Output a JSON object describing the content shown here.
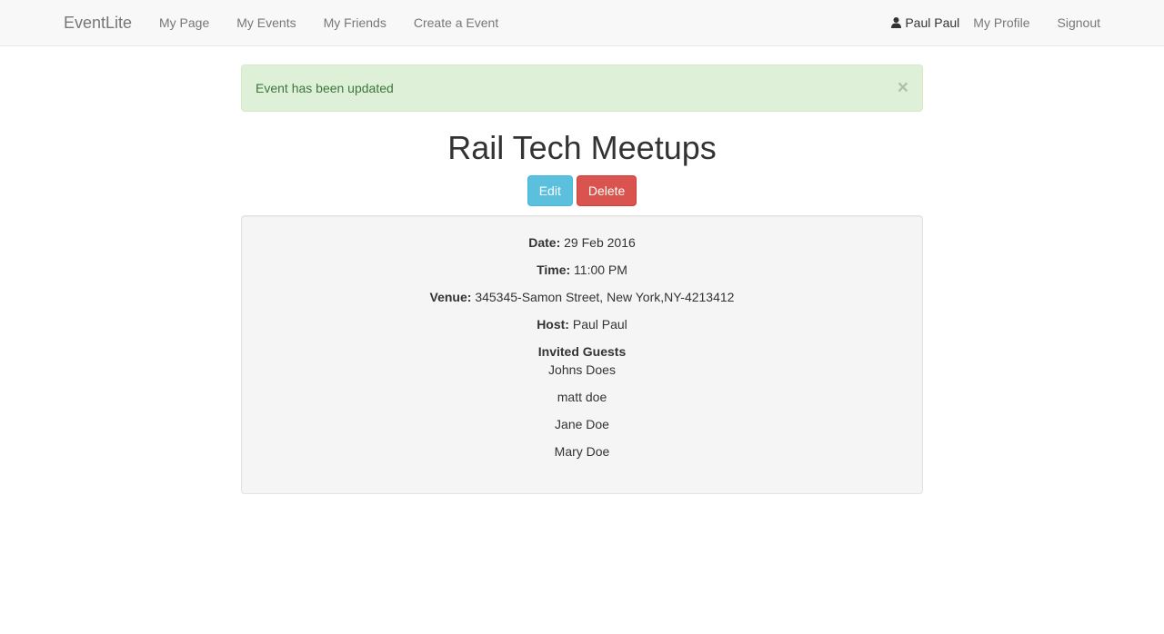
{
  "nav": {
    "brand": "EventLite",
    "links": [
      "My Page",
      "My Events",
      "My Friends",
      "Create a Event"
    ],
    "user_icon": "user-icon",
    "user_name": "Paul Paul",
    "profile": "My Profile",
    "signout": "Signout"
  },
  "alert": {
    "message": "Event has been updated",
    "close": "×"
  },
  "event": {
    "title": "Rail Tech Meetups",
    "edit_label": "Edit",
    "delete_label": "Delete",
    "date_label": "Date:",
    "date": "29 Feb 2016",
    "time_label": "Time:",
    "time": "11:00 PM",
    "venue_label": "Venue:",
    "venue": "345345-Samon Street, New York,NY-4213412",
    "host_label": "Host:",
    "host": "Paul Paul",
    "guests_heading": "Invited Guests",
    "guests": [
      "Johns Does",
      "matt doe",
      "Jane Doe",
      "Mary Doe"
    ]
  },
  "colors": {
    "info": "#5bc0de",
    "danger": "#d9534f",
    "success_bg": "#dff0d8",
    "success_text": "#3c763d"
  }
}
